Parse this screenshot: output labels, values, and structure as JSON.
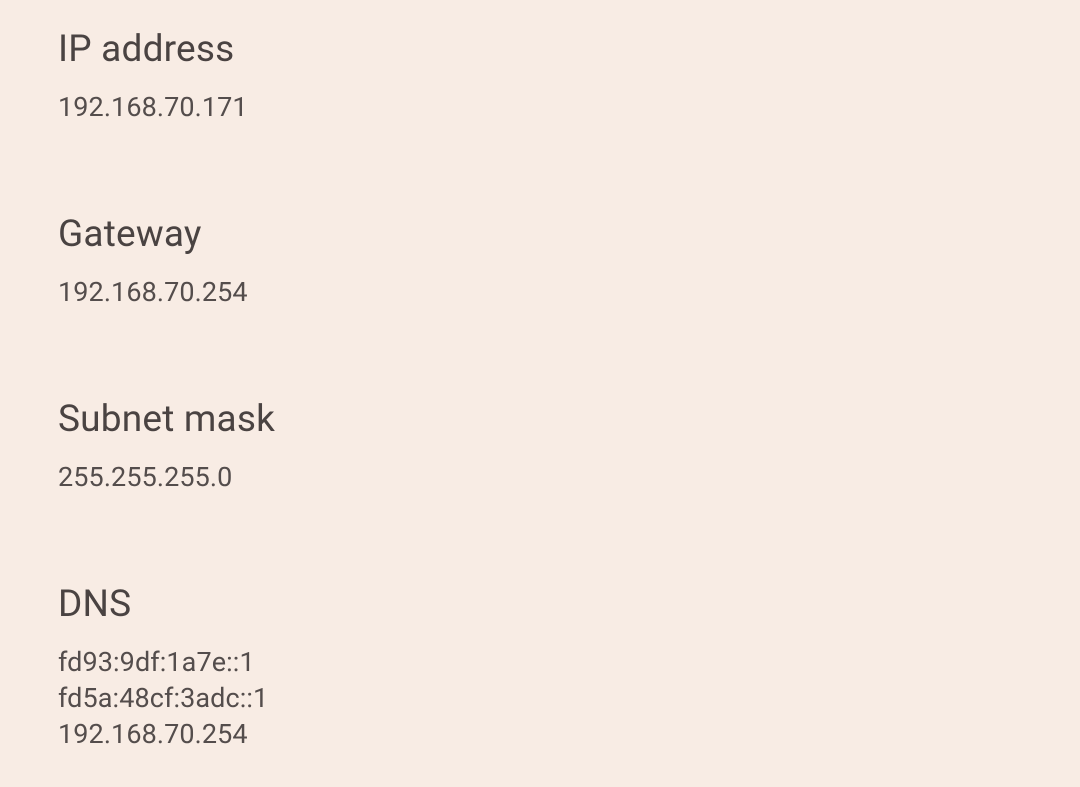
{
  "network": {
    "ip_address": {
      "label": "IP address",
      "value": "192.168.70.171"
    },
    "gateway": {
      "label": "Gateway",
      "value": "192.168.70.254"
    },
    "subnet_mask": {
      "label": "Subnet mask",
      "value": "255.255.255.0"
    },
    "dns": {
      "label": "DNS",
      "value": "fd93:9df:1a7e::1\nfd5a:48cf:3adc::1\n192.168.70.254"
    }
  }
}
